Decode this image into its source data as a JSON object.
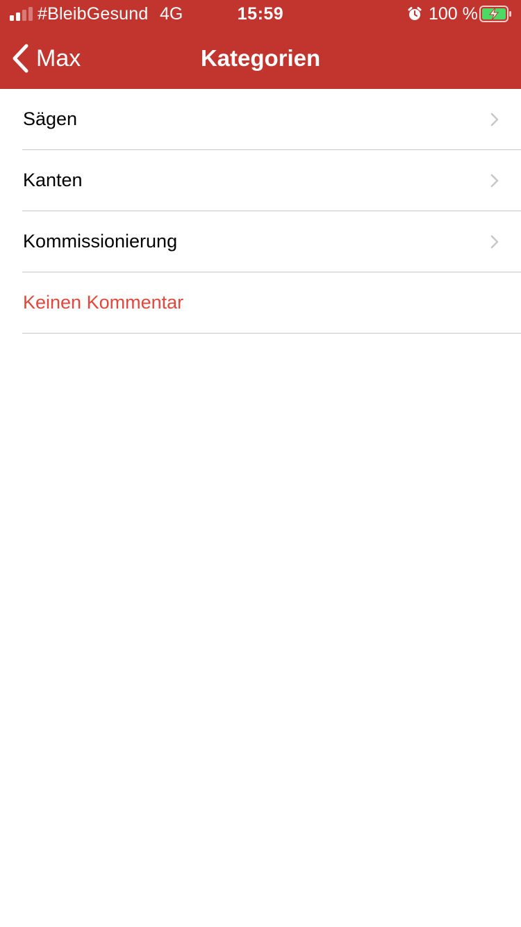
{
  "status_bar": {
    "carrier": "#BleibGesund",
    "network": "4G",
    "time": "15:59",
    "battery_percent": "100 %",
    "icons": [
      "signal-icon",
      "alarm-icon",
      "battery-charging-icon"
    ]
  },
  "nav": {
    "back_label": "Max",
    "title": "Kategorien"
  },
  "list": {
    "items": [
      {
        "label": "Sägen",
        "has_disclosure": true
      },
      {
        "label": "Kanten",
        "has_disclosure": true
      },
      {
        "label": "Kommissionierung",
        "has_disclosure": true
      },
      {
        "label": "Keinen Kommentar",
        "has_disclosure": false
      }
    ]
  },
  "colors": {
    "header_bg": "#c2352f",
    "destructive_text": "#e0483d",
    "separator": "#c8c7cc",
    "chevron": "#c7c7cc",
    "battery_fill": "#4cd964"
  }
}
